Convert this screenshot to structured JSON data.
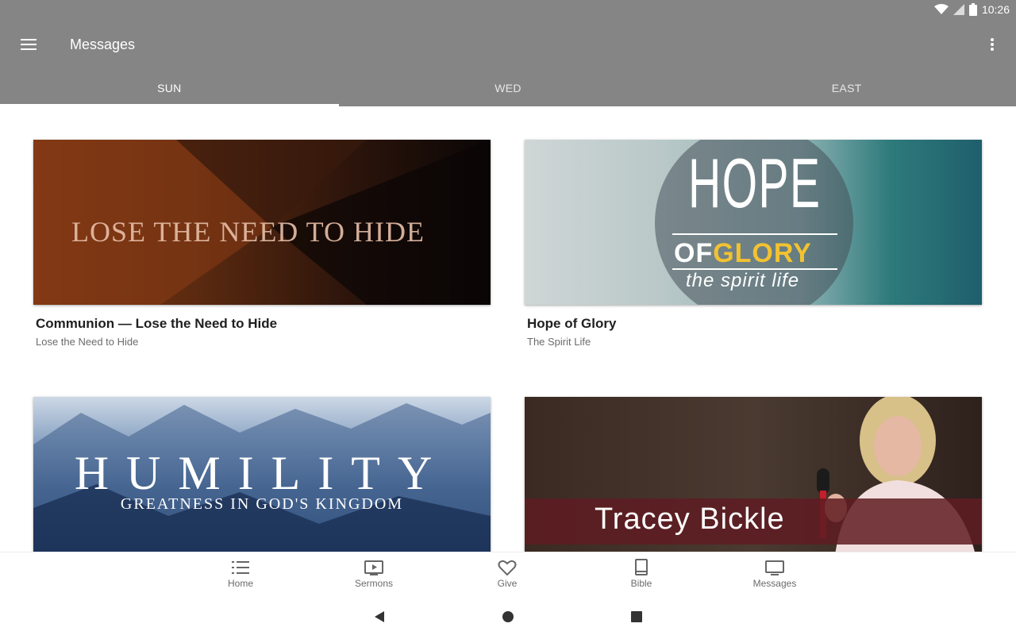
{
  "status": {
    "time": "10:26"
  },
  "appbar": {
    "title": "Messages"
  },
  "tabs": [
    {
      "label": "SUN",
      "active": true
    },
    {
      "label": "WED",
      "active": false
    },
    {
      "label": "EAST",
      "active": false
    }
  ],
  "cards": [
    {
      "title": "Communion — Lose the Need to Hide",
      "subtitle": "Lose the Need to Hide",
      "art_text": "LOSE THE NEED TO HIDE"
    },
    {
      "title": "Hope of Glory",
      "subtitle": "The Spirit Life",
      "art_text": {
        "hope": "HOPE",
        "of": "OF",
        "glory": "GLORY",
        "tagline": "the spirit life"
      }
    },
    {
      "title": "",
      "subtitle": "",
      "art_text": {
        "main": "HUMILITY",
        "sub": "GREATNESS IN GOD'S KINGDOM"
      }
    },
    {
      "title": "",
      "subtitle": "",
      "art_text": "Tracey Bickle"
    }
  ],
  "bottom_nav": [
    {
      "label": "Home",
      "icon": "list-icon"
    },
    {
      "label": "Sermons",
      "icon": "play-screen-icon"
    },
    {
      "label": "Give",
      "icon": "heart-icon"
    },
    {
      "label": "Bible",
      "icon": "book-icon"
    },
    {
      "label": "Messages",
      "icon": "monitor-icon"
    }
  ],
  "colors": {
    "appbar": "#858585",
    "accent": "#f2c230"
  }
}
